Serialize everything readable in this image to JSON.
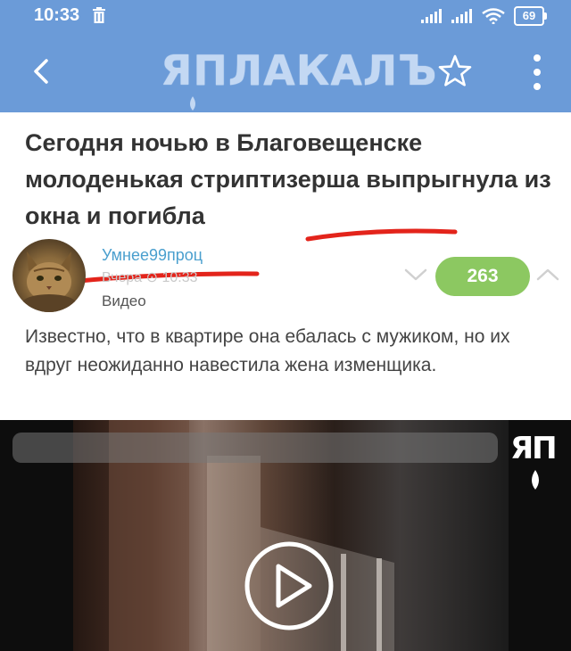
{
  "status_bar": {
    "time": "10:33",
    "battery": "69"
  },
  "app_bar": {
    "logo": "ЯПЛАКАЛЪ"
  },
  "post": {
    "title": "Сегодня ночью в Благовещенске молоденькая стриптизерша выпрыгнула из окна и погибла",
    "author": "Умнее99проц",
    "time": "Вчера ⊙ 10:33",
    "type": "Видео",
    "score": "263",
    "body": "Известно, что в квартире она ебалась с мужиком, но их вдруг неожиданно навестила жена изменщика."
  },
  "video": {
    "watermark": "ЯП"
  },
  "colors": {
    "header": "#6b9bd8",
    "score_bg": "#8cc861",
    "author": "#4a9fce",
    "annotation": "#e3241b"
  }
}
